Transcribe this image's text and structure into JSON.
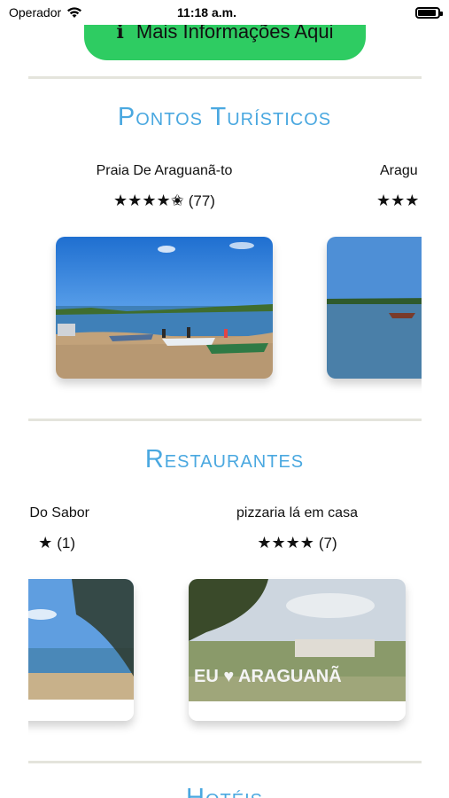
{
  "status_bar": {
    "carrier": "Operador",
    "time": "11:18 a.m."
  },
  "info_button": {
    "icon_glyph": "i",
    "label": "Mais Informações Aqui"
  },
  "sections": {
    "tourist": {
      "title": "Pontos Turísticos",
      "items": [
        {
          "name": "Praia De Araguanã-to",
          "stars": "★★★★✬",
          "count": "(77)"
        },
        {
          "name": "Aragu",
          "stars": "★★★",
          "count": ""
        }
      ]
    },
    "restaurants": {
      "title": "Restaurantes",
      "items": [
        {
          "name": "Do Sabor",
          "stars": "★",
          "count": "(1)"
        },
        {
          "name": "pizzaria lá em casa",
          "stars": "★★★★",
          "count": "(7)"
        }
      ]
    },
    "hotels": {
      "title": "Hotéis"
    }
  },
  "photos": {
    "sign_text": "EU ♥ ARAGUANÃ"
  },
  "colors": {
    "accent_blue": "#4aa8e0",
    "button_green": "#2ecc62",
    "divider": "#e4e4dc"
  }
}
